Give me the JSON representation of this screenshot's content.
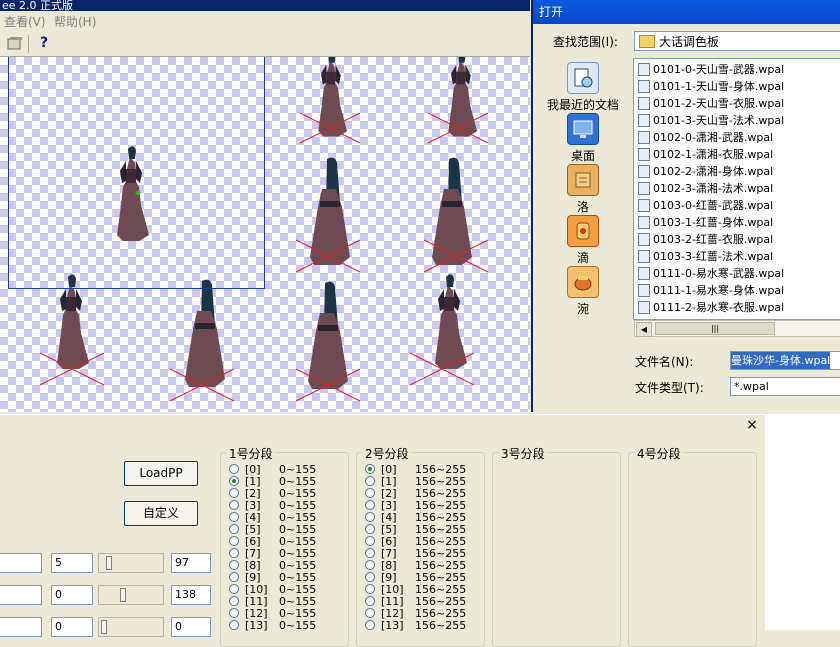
{
  "main_window": {
    "title": "ee 2.0 正式版",
    "menu": [
      "查看(V)",
      "帮助(H)"
    ],
    "toolbar": {
      "icon1": "properties-icon",
      "icon2": "help-icon",
      "help_glyph": "?"
    }
  },
  "dialog": {
    "title": "打开",
    "look_in_label": "查找范围(I):",
    "look_in_value": "大话调色板",
    "places": [
      {
        "label": "我最近的文档",
        "icon": "recent-documents-icon"
      },
      {
        "label": "桌面",
        "icon": "desktop-icon"
      },
      {
        "label": "洛",
        "icon": "scroll-icon"
      },
      {
        "label": "滴",
        "icon": "lamp-icon"
      },
      {
        "label": "涴",
        "icon": "pot-icon"
      }
    ],
    "files": [
      "0101-0-天山雪-武器.wpal",
      "0101-1-天山雪-身体.wpal",
      "0101-2-天山雪-衣服.wpal",
      "0101-3-天山雪-法术.wpal",
      "0102-0-潇湘-武器.wpal",
      "0102-1-潇湘-衣服.wpal",
      "0102-2-潇湘-身体.wpal",
      "0102-3-潇湘-法术.wpal",
      "0103-0-红蔷-武器.wpal",
      "0103-1-红蔷-身体.wpal",
      "0103-2-红蔷-衣服.wpal",
      "0103-3-红蔷-法术.wpal",
      "0111-0-易水寒-武器.wpal",
      "0111-1-易水寒-身体.wpal",
      "0111-2-易水寒-衣服.wpal"
    ],
    "file_name_label": "文件名(N):",
    "file_name_value": "曼珠沙华-身体.wpal",
    "file_type_label": "文件类型(T):",
    "file_type_value": "*.wpal"
  },
  "panel": {
    "close_glyph": "×",
    "loadpp_label": "LoadPP",
    "custom_label": "自定义",
    "rows": [
      {
        "value_a": "5",
        "value_b": "97",
        "slider_level": 0.1
      },
      {
        "value_a": "0",
        "value_b": "138",
        "slider_level": 0.35
      },
      {
        "value_a": "0",
        "value_b": "0",
        "slider_level": 0.0
      }
    ],
    "segments": [
      {
        "title": "1号分段",
        "selected": 1,
        "options": [
          {
            "index": "[0]",
            "range": "0~155"
          },
          {
            "index": "[1]",
            "range": "0~155"
          },
          {
            "index": "[2]",
            "range": "0~155"
          },
          {
            "index": "[3]",
            "range": "0~155"
          },
          {
            "index": "[4]",
            "range": "0~155"
          },
          {
            "index": "[5]",
            "range": "0~155"
          },
          {
            "index": "[6]",
            "range": "0~155"
          },
          {
            "index": "[7]",
            "range": "0~155"
          },
          {
            "index": "[8]",
            "range": "0~155"
          },
          {
            "index": "[9]",
            "range": "0~155"
          },
          {
            "index": "[10]",
            "range": "0~155"
          },
          {
            "index": "[11]",
            "range": "0~155"
          },
          {
            "index": "[12]",
            "range": "0~155"
          },
          {
            "index": "[13]",
            "range": "0~155"
          }
        ]
      },
      {
        "title": "2号分段",
        "selected": 0,
        "options": [
          {
            "index": "[0]",
            "range": "156~255"
          },
          {
            "index": "[1]",
            "range": "156~255"
          },
          {
            "index": "[2]",
            "range": "156~255"
          },
          {
            "index": "[3]",
            "range": "156~255"
          },
          {
            "index": "[4]",
            "range": "156~255"
          },
          {
            "index": "[5]",
            "range": "156~255"
          },
          {
            "index": "[6]",
            "range": "156~255"
          },
          {
            "index": "[7]",
            "range": "156~255"
          },
          {
            "index": "[8]",
            "range": "156~255"
          },
          {
            "index": "[9]",
            "range": "156~255"
          },
          {
            "index": "[10]",
            "range": "156~255"
          },
          {
            "index": "[11]",
            "range": "156~255"
          },
          {
            "index": "[12]",
            "range": "156~255"
          },
          {
            "index": "[13]",
            "range": "156~255"
          }
        ]
      },
      {
        "title": "3号分段",
        "selected": -1,
        "options": []
      },
      {
        "title": "4号分段",
        "selected": -1,
        "options": []
      }
    ]
  },
  "colors": {
    "checker": "#c8c8f0",
    "selection_border": "#1c3ea0",
    "title_blue": "#0a246a",
    "sprite_dark": "#2a2430",
    "sprite_robe": "#6e4a52",
    "sprite_hair": "#1e3248",
    "ground_marker": "#e02020"
  }
}
